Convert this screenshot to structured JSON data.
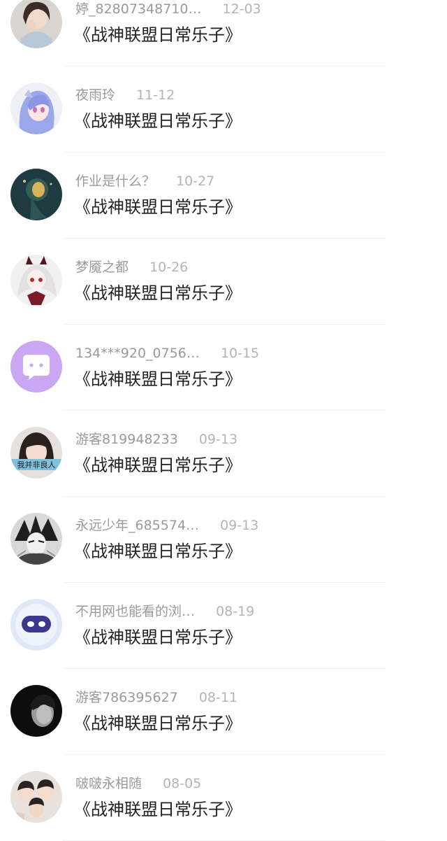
{
  "comments": [
    {
      "username": "婷_82807348710…",
      "date": "12-03",
      "message": "《战神联盟日常乐子》",
      "avatar": "girl-photo-avatar"
    },
    {
      "username": "夜雨玲",
      "date": "11-12",
      "message": "《战神联盟日常乐子》",
      "avatar": "anime-girl-avatar"
    },
    {
      "username": "作业是什么？",
      "date": "10-27",
      "message": "《战神联盟日常乐子》",
      "avatar": "dark-scene-avatar"
    },
    {
      "username": "梦魇之都",
      "date": "10-26",
      "message": "《战神联盟日常乐子》",
      "avatar": "anime-bunny-avatar"
    },
    {
      "username": "134***920_0756…",
      "date": "10-15",
      "message": "《战神联盟日常乐子》",
      "avatar": "purple-chat-bubble-avatar"
    },
    {
      "username": "游客819948233",
      "date": "09-13",
      "message": "《战神联盟日常乐子》",
      "avatar": "girl-with-caption-avatar",
      "avatar_caption": "我并非良人"
    },
    {
      "username": "永远少年_685574…",
      "date": "09-13",
      "message": "《战神联盟日常乐子》",
      "avatar": "manga-character-avatar"
    },
    {
      "username": "不用网也能看的浏…",
      "date": "08-19",
      "message": "《战神联盟日常乐子》",
      "avatar": "robot-face-avatar"
    },
    {
      "username": "游客786395627",
      "date": "08-11",
      "message": "《战神联盟日常乐子》",
      "avatar": "bw-photo-avatar"
    },
    {
      "username": "啵啵永相随",
      "date": "08-05",
      "message": "《战神联盟日常乐子》",
      "avatar": "group-photo-avatar"
    }
  ],
  "colors": {
    "username": "#9a9a9a",
    "date": "#b4b4b4",
    "message": "#222222",
    "divider": "#f1f1f1",
    "accent_purple": "#c9a7f2"
  }
}
